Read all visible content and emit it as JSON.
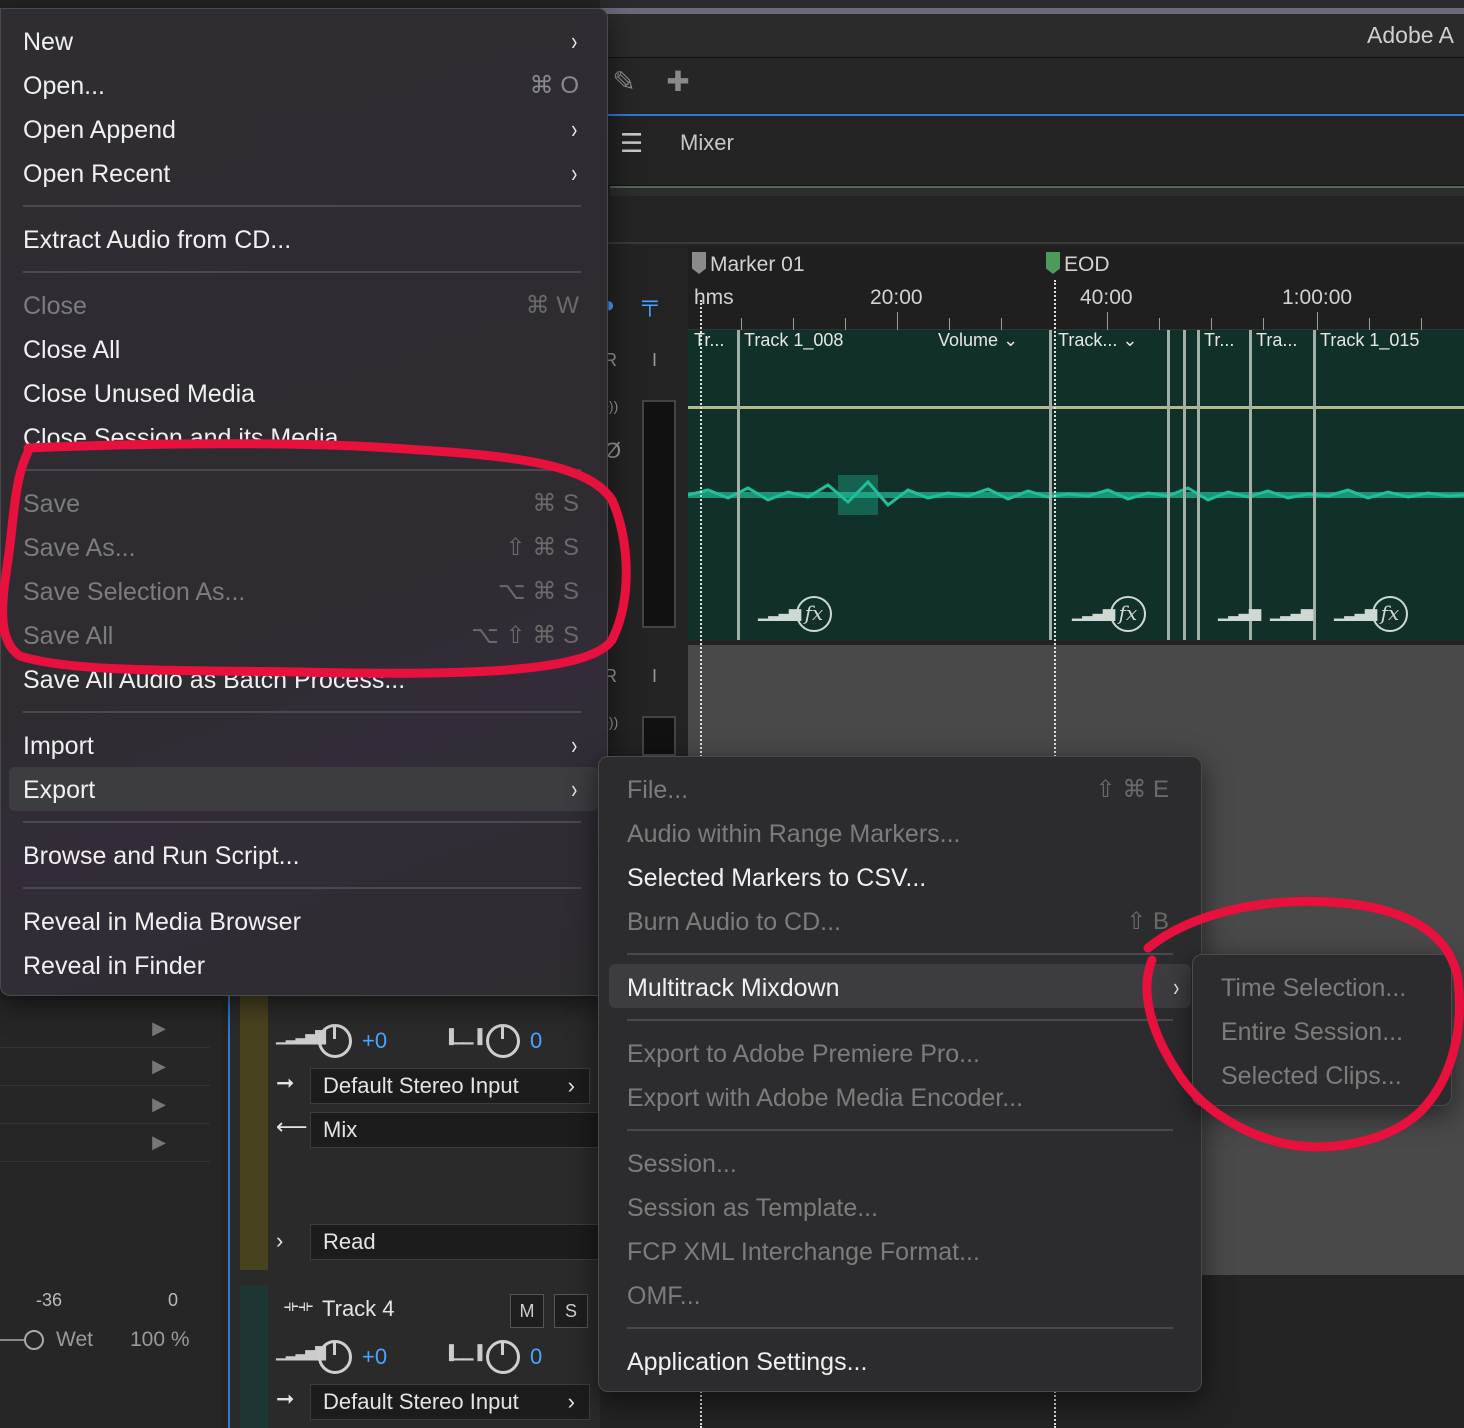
{
  "app": {
    "title": "Adobe A"
  },
  "panel": {
    "menu_icon": "☰",
    "tab_label": "Mixer"
  },
  "markers": {
    "m1": "Marker 01",
    "m2": "EOD"
  },
  "ruler": {
    "l0": "hms",
    "l1": "20:00",
    "l2": "40:00",
    "l3": "1:00:00"
  },
  "clips": {
    "c1": "Tr...",
    "c2": "Track 1_008",
    "vol": "Volume",
    "c3": "Track...",
    "c4": "Tr...",
    "c5": "Tra...",
    "c6": "Track 1_015"
  },
  "fx_label": "fx",
  "strip_ctrls": {
    "r": "R",
    "i": "I",
    "mono": "•))",
    "phase": "Ø"
  },
  "left_panel": {
    "scale_a": "-36",
    "scale_b": "0",
    "wet_label": "Wet",
    "wet_value": "100 %"
  },
  "mixer": {
    "track3_pan": "+0",
    "track3_width": "0",
    "track3_input": "Default Stereo Input",
    "track3_output": "Mix",
    "track3_automation": "Read",
    "track4_name": "Track 4",
    "track4_m": "M",
    "track4_s": "S",
    "track4_pan": "+0",
    "track4_width": "0",
    "track4_input": "Default Stereo Input"
  },
  "file_menu": {
    "new": "New",
    "open": "Open...",
    "open_sc": "⌘ O",
    "open_append": "Open Append",
    "open_recent": "Open Recent",
    "extract": "Extract Audio from CD...",
    "close": "Close",
    "close_sc": "⌘ W",
    "close_all": "Close All",
    "close_unused": "Close Unused Media",
    "close_session": "Close Session and its Media",
    "save": "Save",
    "save_sc": "⌘ S",
    "save_as": "Save As...",
    "save_as_sc": "⇧ ⌘ S",
    "save_sel": "Save Selection As...",
    "save_sel_sc": "⌥ ⌘ S",
    "save_all": "Save All",
    "save_all_sc": "⌥ ⇧ ⌘ S",
    "save_batch": "Save All Audio as Batch Process...",
    "import": "Import",
    "export": "Export",
    "browse": "Browse and Run Script...",
    "reveal_browser": "Reveal in Media Browser",
    "reveal_finder": "Reveal in Finder"
  },
  "export_menu": {
    "file": "File...",
    "file_sc": "⇧ ⌘ E",
    "range": "Audio within Range Markers...",
    "csv": "Selected Markers to CSV...",
    "burn": "Burn Audio to CD...",
    "burn_sc": "⇧ B",
    "mixdown": "Multitrack Mixdown",
    "premiere": "Export to Adobe Premiere Pro...",
    "encoder": "Export with Adobe Media Encoder...",
    "session": "Session...",
    "template": "Session as Template...",
    "fcp": "FCP XML Interchange Format...",
    "omf": "OMF...",
    "settings": "Application Settings..."
  },
  "mixdown_menu": {
    "time_sel": "Time Selection...",
    "entire": "Entire Session...",
    "clips": "Selected Clips..."
  },
  "colors": {
    "accent": "#2e78d6",
    "annotation": "#e8103c",
    "waveform": "#1fbf9a"
  },
  "icons": {
    "chevron": "›"
  }
}
